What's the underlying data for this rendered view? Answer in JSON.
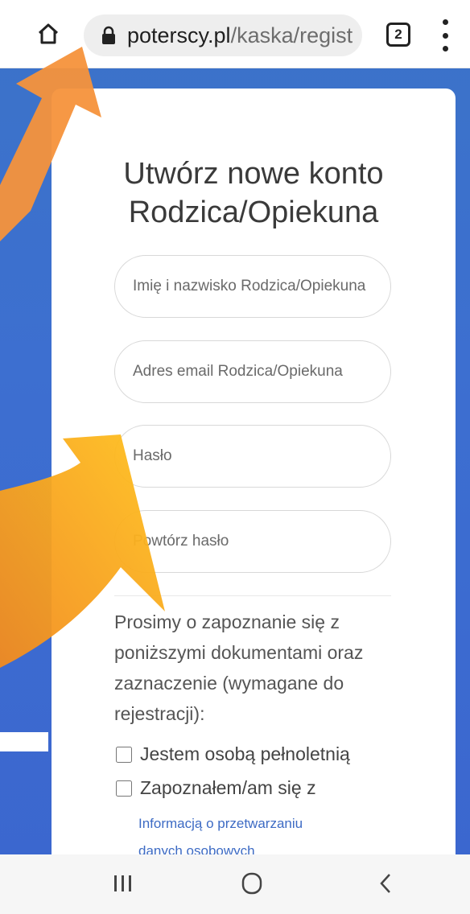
{
  "browser": {
    "url_host": "poterscy.pl",
    "url_path": "/kaska/regist",
    "tab_count": "2"
  },
  "form": {
    "title_line1": "Utwórz nowe konto",
    "title_line2": "Rodzica/Opiekuna",
    "name_placeholder": "Imię i nazwisko Rodzica/Opiekuna",
    "email_placeholder": "Adres email Rodzica/Opiekuna",
    "password_placeholder": "Hasło",
    "repeat_password_placeholder": "Powtórz hasło",
    "info_text": "Prosimy o zapoznanie się z poniższymi dokumentami oraz zaznaczenie (wymagane do rejestracji):",
    "checkbox_adult": "Jestem osobą pełnoletnią",
    "checkbox_read": "Zapoznałem/am się z",
    "link_line1": "Informacją o przetwarzaniu",
    "link_line2": "danych osobowych"
  },
  "colors": {
    "background": "#3b6fcf",
    "arrow_orange": "#f5923b",
    "arrow_yellow": "#fbb726",
    "link": "#3d6bc4"
  },
  "icons": {
    "home": "home-icon",
    "lock": "lock-icon",
    "tabs": "tabs-counter-icon",
    "menu": "more-vert-icon",
    "recent": "recent-apps-icon",
    "home_nav": "home-circle-icon",
    "back": "back-icon"
  }
}
